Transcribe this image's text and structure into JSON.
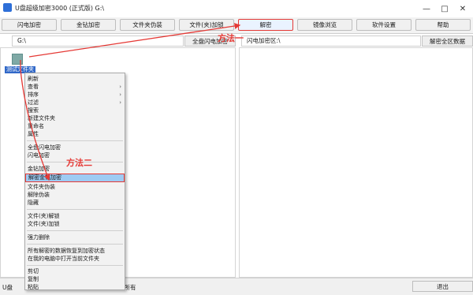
{
  "window": {
    "title": "U盘超级加密3000 (正式版)   G:\\",
    "minimize": "—",
    "maximize": "□",
    "close": "✕"
  },
  "toolbar": {
    "buttons": [
      {
        "label": "闪电加密",
        "highlighted": false
      },
      {
        "label": "金钻加密",
        "highlighted": false
      },
      {
        "label": "文件夹伪装",
        "highlighted": false
      },
      {
        "label": "文件(夹)加锁",
        "highlighted": false
      },
      {
        "label": "解密",
        "highlighted": true
      },
      {
        "label": "镜像浏览",
        "highlighted": false
      },
      {
        "label": "软件设置",
        "highlighted": false
      },
      {
        "label": "帮助",
        "highlighted": false
      }
    ]
  },
  "left_path": {
    "value": "G:\\",
    "action": "全盘闪电加密"
  },
  "right_path": {
    "value": "闪电加密区:\\",
    "action": "解密全区数据"
  },
  "left_pane": {
    "folder_label": "测试文件夹"
  },
  "context_menu": {
    "items": [
      {
        "label": "刷新",
        "submenu": false
      },
      {
        "label": "查看",
        "submenu": true
      },
      {
        "label": "排序",
        "submenu": true
      },
      {
        "label": "过滤",
        "submenu": true
      },
      {
        "label": "搜索",
        "submenu": false
      },
      {
        "label": "新建文件夹",
        "submenu": false
      },
      {
        "label": "重命名",
        "submenu": false
      },
      {
        "label": "属性",
        "submenu": false
      },
      {
        "label": "全盘闪电加密",
        "submenu": false
      },
      {
        "label": "闪电加密",
        "submenu": false
      },
      {
        "label": "金钻加密",
        "submenu": false
      },
      {
        "label": "解密金钻加密",
        "submenu": false,
        "highlighted": true
      },
      {
        "label": "文件夹伪装",
        "submenu": false
      },
      {
        "label": "解除伪装",
        "submenu": false
      },
      {
        "label": "隐藏",
        "submenu": false
      },
      {
        "label": "文件(夹)解锁",
        "submenu": false
      },
      {
        "label": "文件(夹)加锁",
        "submenu": false
      },
      {
        "label": "强力删除",
        "submenu": false
      },
      {
        "label": "所有解密的数据恢复到加密状态",
        "submenu": false
      },
      {
        "label": "在我的电脑中打开当前文件夹",
        "submenu": false
      },
      {
        "label": "剪切",
        "submenu": false
      },
      {
        "label": "复制",
        "submenu": false
      },
      {
        "label": "粘贴",
        "submenu": false
      }
    ]
  },
  "annotations": {
    "method_one": "方法一",
    "method_two": "方法二",
    "color": "#e53935"
  },
  "statusbar": {
    "left": "U盘",
    "mid": "权所有",
    "exit": "退出"
  }
}
